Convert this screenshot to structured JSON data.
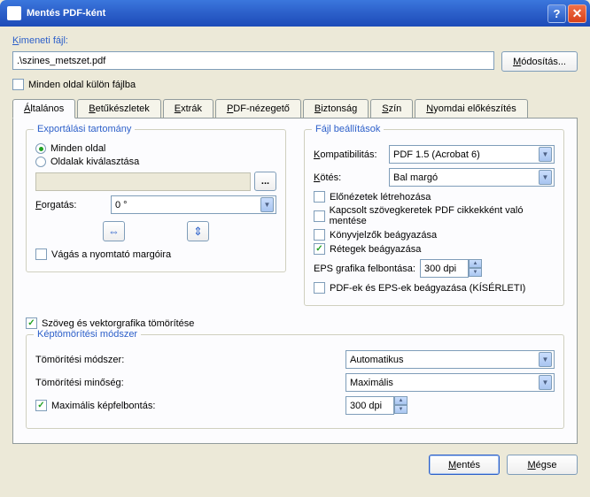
{
  "window": {
    "title": "Mentés PDF-ként"
  },
  "output": {
    "label": "Kimeneti fájl:",
    "file_value": ".\\szines_metszet.pdf",
    "modify_btn": "Módosítás...",
    "separate_files": "Minden oldal külön fájlba"
  },
  "tabs": {
    "general": "Általános",
    "fonts": "Betűkészletek",
    "extras": "Extrák",
    "viewer": "PDF-nézegető",
    "security": "Biztonság",
    "color": "Szín",
    "prepress": "Nyomdai előkészítés"
  },
  "export_range": {
    "title": "Exportálási tartomány",
    "all_pages": "Minden oldal",
    "select_pages": "Oldalak kiválasztása",
    "rotation_label": "Forgatás:",
    "rotation_value": "0 °",
    "crop": "Vágás a nyomtató margóira"
  },
  "file_settings": {
    "title": "Fájl beállítások",
    "compat_label": "Kompatibilitás:",
    "compat_value": "PDF 1.5 (Acrobat 6)",
    "binding_label": "Kötés:",
    "binding_value": "Bal margó",
    "thumbnails": "Előnézetek létrehozása",
    "linked_frames": "Kapcsolt szövegkeretek PDF cikkekként való mentése",
    "bookmarks": "Könyvjelzők beágyazása",
    "layers": "Rétegek beágyazása",
    "eps_res_label": "EPS grafika felbontása:",
    "eps_res_value": "300 dpi",
    "embed_pdf_eps": "PDF-ek és EPS-ek beágyazása (KÍSÉRLETI)"
  },
  "compress_text": "Szöveg és vektorgrafika tömörítése",
  "image_compress": {
    "title": "Képtömörítési módszer",
    "method_label": "Tömörítési módszer:",
    "method_value": "Automatikus",
    "quality_label": "Tömörítési minőség:",
    "quality_value": "Maximális",
    "max_res_label": "Maximális képfelbontás:",
    "max_res_value": "300 dpi"
  },
  "buttons": {
    "save": "Mentés",
    "cancel": "Mégse"
  }
}
